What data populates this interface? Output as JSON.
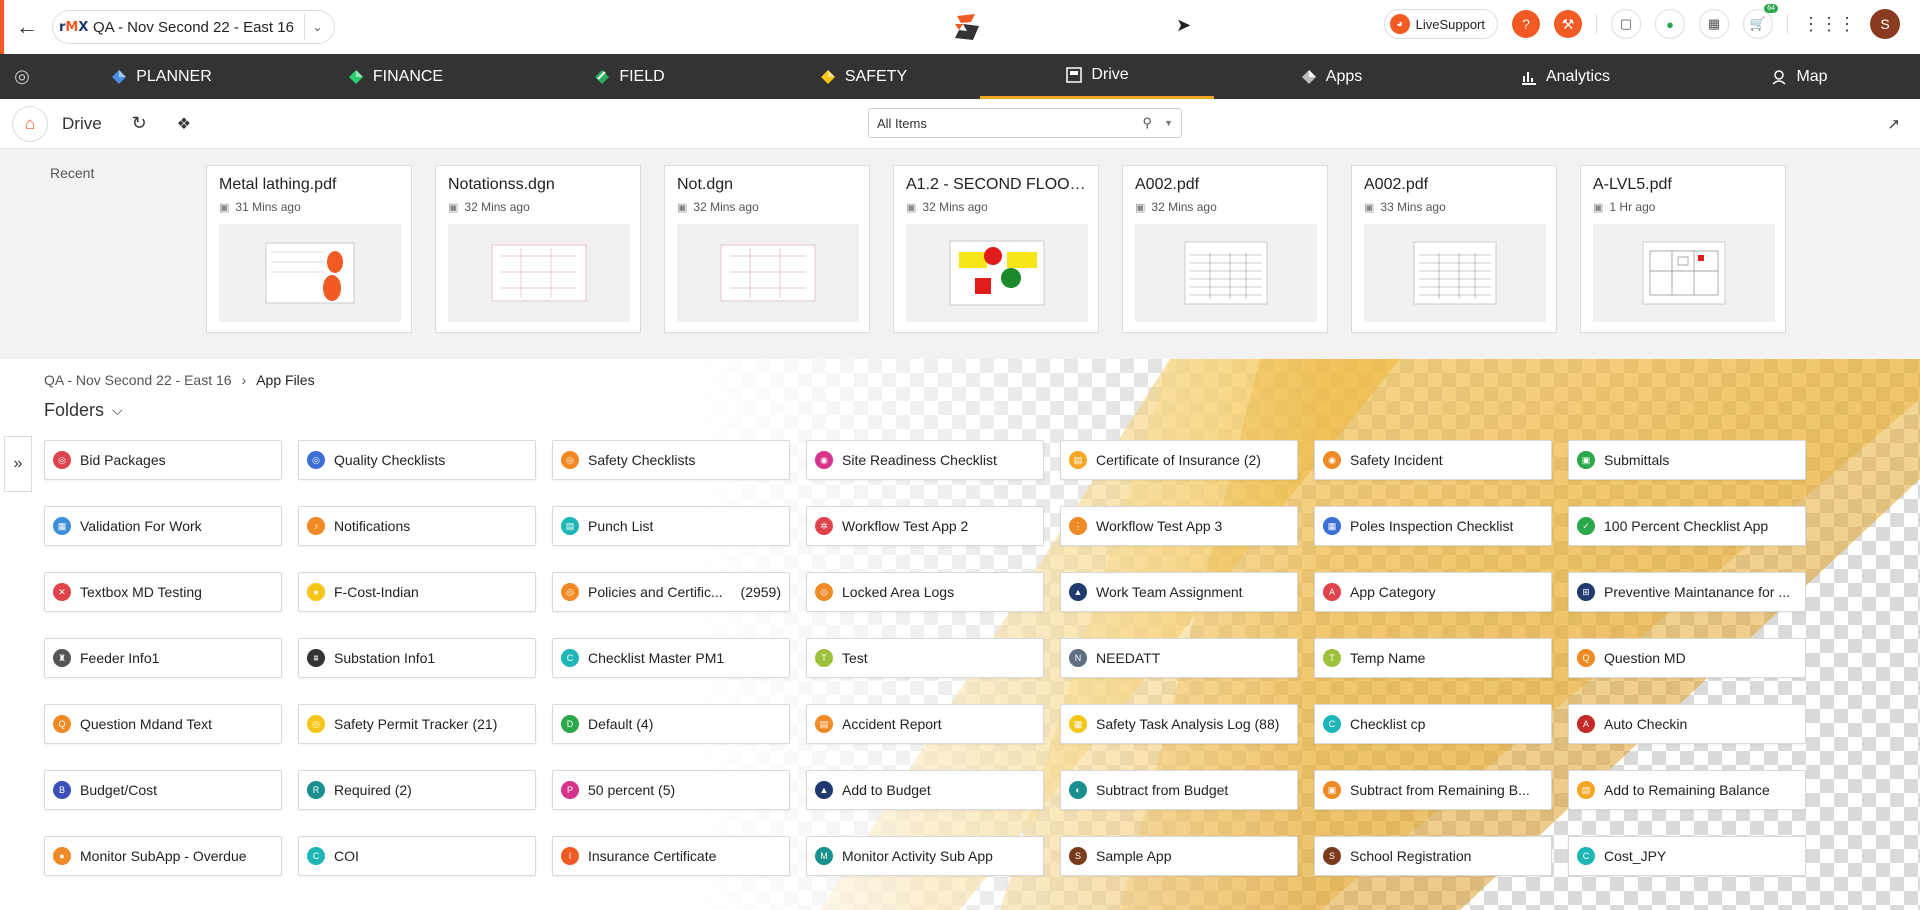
{
  "topbar": {
    "project_name": "QA - Nov Second 22 - East 16",
    "live_support_label": "LiveSupport",
    "cart_badge": "64",
    "avatar_initial": "S"
  },
  "nav": {
    "items": [
      {
        "label": "PLANNER",
        "icon": "planner-icon"
      },
      {
        "label": "FINANCE",
        "icon": "finance-icon"
      },
      {
        "label": "FIELD",
        "icon": "field-icon"
      },
      {
        "label": "SAFETY",
        "icon": "safety-icon"
      },
      {
        "label": "Drive",
        "icon": "drive-icon",
        "active": true
      },
      {
        "label": "Apps",
        "icon": "apps-icon"
      },
      {
        "label": "Analytics",
        "icon": "analytics-icon"
      },
      {
        "label": "Map",
        "icon": "map-icon"
      }
    ]
  },
  "subheader": {
    "title": "Drive",
    "search_value": "All Items"
  },
  "recent": {
    "label": "Recent",
    "files": [
      {
        "name": "Metal lathing.pdf",
        "time": "31 Mins ago"
      },
      {
        "name": "Notationss.dgn",
        "time": "32 Mins ago"
      },
      {
        "name": "Not.dgn",
        "time": "32 Mins ago"
      },
      {
        "name": "A1.2 - SECOND FLOOR ...",
        "time": "32 Mins ago"
      },
      {
        "name": "A002.pdf",
        "time": "32 Mins ago"
      },
      {
        "name": "A002.pdf",
        "time": "33 Mins ago"
      },
      {
        "name": "A-LVL5.pdf",
        "time": "1 Hr ago"
      }
    ]
  },
  "breadcrumb": {
    "root": "QA - Nov Second 22 - East 16",
    "current": "App Files"
  },
  "folders": {
    "heading": "Folders",
    "items": [
      {
        "name": "Bid Packages",
        "count": "",
        "color": "#e0434b",
        "glyph": "◎"
      },
      {
        "name": "Quality Checklists",
        "count": "",
        "color": "#3b6fd8",
        "glyph": "◎"
      },
      {
        "name": "Safety Checklists",
        "count": "",
        "color": "#f08a24",
        "glyph": "◎"
      },
      {
        "name": "Site Readiness Checklist",
        "count": "",
        "color": "#d6338a",
        "glyph": "◉"
      },
      {
        "name": "Certificate of Insurance (2)",
        "count": "",
        "color": "#f5a623",
        "glyph": "▤"
      },
      {
        "name": "Safety Incident",
        "count": "",
        "color": "#f08a24",
        "glyph": "◉"
      },
      {
        "name": "Submittals",
        "count": "",
        "color": "#2aa84a",
        "glyph": "▣"
      },
      {
        "name": "Validation For Work",
        "count": "",
        "color": "#3b8fd8",
        "glyph": "▦"
      },
      {
        "name": "Notifications",
        "count": "",
        "color": "#f08a24",
        "glyph": "♪"
      },
      {
        "name": "Punch List",
        "count": "",
        "color": "#1db5b5",
        "glyph": "▤"
      },
      {
        "name": "Workflow Test App 2",
        "count": "",
        "color": "#e0434b",
        "glyph": "✲"
      },
      {
        "name": "Workflow Test App 3",
        "count": "",
        "color": "#f08a24",
        "glyph": "⋮"
      },
      {
        "name": "Poles Inspection Checklist",
        "count": "",
        "color": "#3b6fd8",
        "glyph": "▦"
      },
      {
        "name": "100 Percent Checklist App",
        "count": "",
        "color": "#2aa84a",
        "glyph": "✓"
      },
      {
        "name": "Textbox MD Testing",
        "count": "",
        "color": "#e0434b",
        "glyph": "✕"
      },
      {
        "name": "F-Cost-Indian",
        "count": "",
        "color": "#f5c518",
        "glyph": "●"
      },
      {
        "name": "Policies and Certific...",
        "count": "(2959)",
        "color": "#f08a24",
        "glyph": "◎"
      },
      {
        "name": "Locked Area Logs",
        "count": "",
        "color": "#f08a24",
        "glyph": "◎"
      },
      {
        "name": "Work Team Assignment",
        "count": "",
        "color": "#1e3a6e",
        "glyph": "▲"
      },
      {
        "name": "App Category",
        "count": "",
        "color": "#e0434b",
        "glyph": "A"
      },
      {
        "name": "Preventive Maintanance for ...",
        "count": "",
        "color": "#1e3a6e",
        "glyph": "⊞"
      },
      {
        "name": "Feeder Info1",
        "count": "",
        "color": "#555555",
        "glyph": "♜"
      },
      {
        "name": "Substation Info1",
        "count": "",
        "color": "#333333",
        "glyph": "⩩"
      },
      {
        "name": "Checklist Master PM1",
        "count": "",
        "color": "#1db5b5",
        "glyph": "C"
      },
      {
        "name": "Test",
        "count": "",
        "color": "#9cc03a",
        "glyph": "T"
      },
      {
        "name": "NEEDATT",
        "count": "",
        "color": "#607080",
        "glyph": "N"
      },
      {
        "name": "Temp Name",
        "count": "",
        "color": "#9cc03a",
        "glyph": "T"
      },
      {
        "name": "Question MD",
        "count": "",
        "color": "#f08a24",
        "glyph": "Q"
      },
      {
        "name": "Question Mdand Text",
        "count": "",
        "color": "#f08a24",
        "glyph": "Q"
      },
      {
        "name": "Safety Permit Tracker (21)",
        "count": "",
        "color": "#f5c518",
        "glyph": "◎"
      },
      {
        "name": "Default (4)",
        "count": "",
        "color": "#2aa84a",
        "glyph": "D"
      },
      {
        "name": "Accident Report",
        "count": "",
        "color": "#f08a24",
        "glyph": "▤"
      },
      {
        "name": "Safety Task Analysis Log (88)",
        "count": "",
        "color": "#f5c518",
        "glyph": "▦"
      },
      {
        "name": "Checklist cp",
        "count": "",
        "color": "#1db5b5",
        "glyph": "C"
      },
      {
        "name": "Auto Checkin",
        "count": "",
        "color": "#c62828",
        "glyph": "A"
      },
      {
        "name": "Budget/Cost",
        "count": "",
        "color": "#3b4fb8",
        "glyph": "B"
      },
      {
        "name": "Required (2)",
        "count": "",
        "color": "#1a8f8f",
        "glyph": "R"
      },
      {
        "name": "50 percent (5)",
        "count": "",
        "color": "#d6338a",
        "glyph": "P"
      },
      {
        "name": "Add to Budget",
        "count": "",
        "color": "#1e3a6e",
        "glyph": "▲"
      },
      {
        "name": "Subtract from Budget",
        "count": "",
        "color": "#1a8f8f",
        "glyph": "◐"
      },
      {
        "name": "Subtract from Remaining B...",
        "count": "",
        "color": "#f08a24",
        "glyph": "▣"
      },
      {
        "name": "Add to Remaining Balance",
        "count": "",
        "color": "#f5a623",
        "glyph": "▤"
      },
      {
        "name": "Monitor SubApp - Overdue",
        "count": "",
        "color": "#f08a24",
        "glyph": "●"
      },
      {
        "name": "COI",
        "count": "",
        "color": "#1db5b5",
        "glyph": "C"
      },
      {
        "name": "Insurance Certificate",
        "count": "",
        "color": "#f15a22",
        "glyph": "I"
      },
      {
        "name": "Monitor Activity Sub App",
        "count": "",
        "color": "#1a8f8f",
        "glyph": "M"
      },
      {
        "name": "Sample App",
        "count": "",
        "color": "#7a3a1e",
        "glyph": "S"
      },
      {
        "name": "School Registration",
        "count": "",
        "color": "#7a3a1e",
        "glyph": "S"
      },
      {
        "name": "Cost_JPY",
        "count": "",
        "color": "#1db5b5",
        "glyph": "C"
      }
    ]
  }
}
